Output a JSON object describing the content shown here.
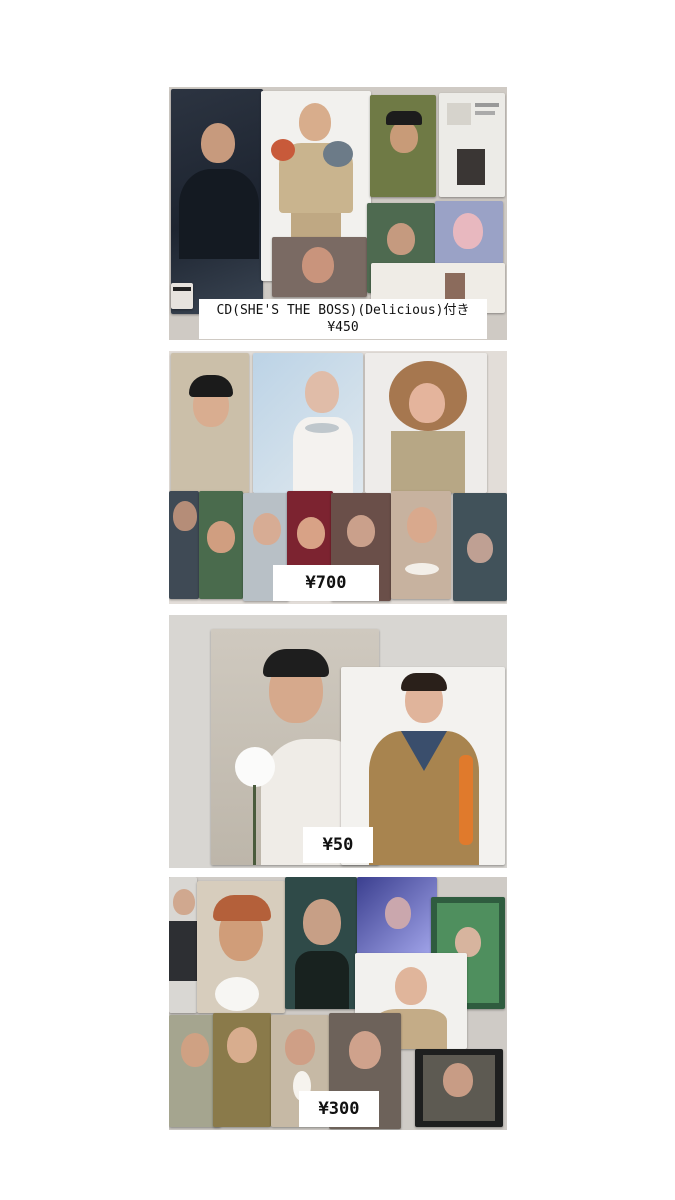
{
  "listings": [
    {
      "caption": "CD(SHE'S THE BOSS)(Delicious)付き",
      "price": "¥450"
    },
    {
      "price": "¥700"
    },
    {
      "price": "¥50"
    },
    {
      "price": "¥300"
    }
  ],
  "colors": {
    "background": "#ffffff",
    "label_bg": "#ffffff",
    "label_text": "#111111"
  }
}
